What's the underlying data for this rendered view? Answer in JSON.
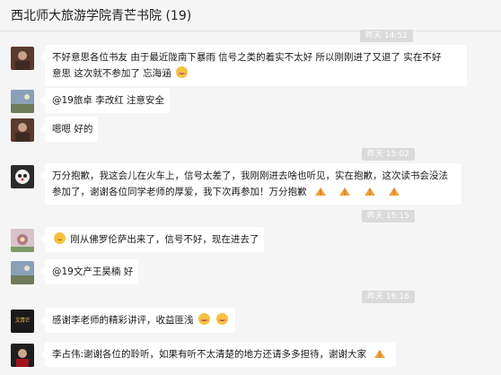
{
  "window": {
    "title": "西北师大旅游学院青芒书院 (19)"
  },
  "timestamps": [
    "昨天 14:52",
    "昨天 15:02",
    "昨天 15:15",
    "昨天 16:16"
  ],
  "messages": [
    {
      "text_line1": "不好意思各位书友  由于最近陇南下暴雨  信号之类的着实不太好  所以刚刚进了又退了  实在不好",
      "text_line2": "意思  这次就不参加了  忘海涵",
      "avatar": "photo-avatar"
    },
    {
      "text": "@19旅卓  李改红 注意安全",
      "avatar": "landscape-avatar"
    },
    {
      "text": "嗯嗯  好的",
      "avatar": "photo-avatar"
    },
    {
      "text_line1": "万分抱歉，我这会儿在火车上，信号太差了，我刚刚进去啥也听见，实在抱歉，这次读书会没法",
      "text_line2": "参加了，谢谢各位同学老师的厚爱，我下次再参加！万分抱歉",
      "avatar": "panda-avatar"
    },
    {
      "text": "刚从佛罗伦萨出来了，信号不好，现在进去了",
      "avatar": "flower-avatar"
    },
    {
      "text": "@19文产王昊楠 好",
      "avatar": "landscape-avatar"
    },
    {
      "text": "感谢李老师的精彩讲评，收益匪浅",
      "avatar": "wenqing-avatar",
      "avatar_text": "文青芒"
    },
    {
      "text": "李占伟:谢谢各位的聆听，如果有听不太清楚的地方还请多多担待，谢谢大家",
      "avatar": "portrait-avatar"
    }
  ],
  "colors": {
    "background": "#f5f5f5",
    "bubble": "#ffffff",
    "timestamp_bg": "#dadada"
  }
}
